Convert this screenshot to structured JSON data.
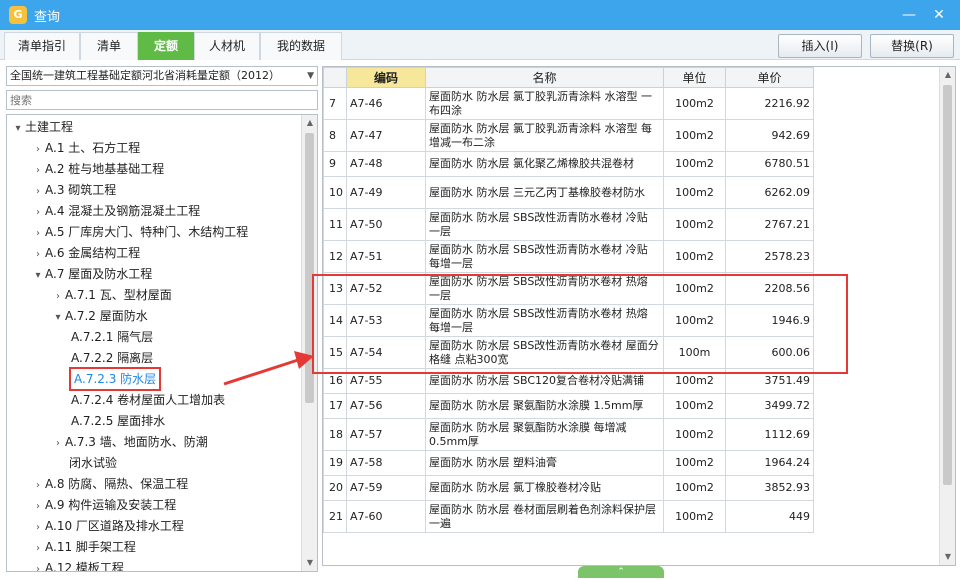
{
  "window": {
    "title": "查询",
    "app_icon": "G",
    "minimize": "—",
    "close": "✕"
  },
  "tabs": [
    "清单指引",
    "清单",
    "定额",
    "人材机",
    "我的数据"
  ],
  "active_tab": 2,
  "actions": {
    "insert": "插入(I)",
    "replace": "替换(R)"
  },
  "left": {
    "dropdown_value": "全国统一建筑工程基础定额河北省消耗量定额（2012）",
    "search_placeholder": "搜索",
    "tree": [
      {
        "label": "土建工程",
        "level": 0,
        "arrow": "▾"
      },
      {
        "label": "A.1 土、石方工程",
        "level": 1,
        "arrow": "›"
      },
      {
        "label": "A.2 桩与地基基础工程",
        "level": 1,
        "arrow": "›"
      },
      {
        "label": "A.3 砌筑工程",
        "level": 1,
        "arrow": "›"
      },
      {
        "label": "A.4 混凝土及钢筋混凝土工程",
        "level": 1,
        "arrow": "›"
      },
      {
        "label": "A.5 厂库房大门、特种门、木结构工程",
        "level": 1,
        "arrow": "›"
      },
      {
        "label": "A.6 金属结构工程",
        "level": 1,
        "arrow": "›"
      },
      {
        "label": "A.7 屋面及防水工程",
        "level": 1,
        "arrow": "▾"
      },
      {
        "label": "A.7.1 瓦、型材屋面",
        "level": 2,
        "arrow": "›"
      },
      {
        "label": "A.7.2 屋面防水",
        "level": 2,
        "arrow": "▾"
      },
      {
        "label": "A.7.2.1 隔气层",
        "level": 3,
        "arrow": ""
      },
      {
        "label": "A.7.2.2 隔离层",
        "level": 3,
        "arrow": ""
      },
      {
        "label": "A.7.2.3 防水层",
        "level": 3,
        "arrow": "",
        "selected": true
      },
      {
        "label": "A.7.2.4 卷材屋面人工增加表",
        "level": 3,
        "arrow": ""
      },
      {
        "label": "A.7.2.5 屋面排水",
        "level": 3,
        "arrow": "›"
      },
      {
        "label": "A.7.3 墙、地面防水、防潮",
        "level": 2,
        "arrow": "›"
      },
      {
        "label": "闭水试验",
        "level": 2,
        "arrow": "",
        "continuation": true
      },
      {
        "label": "A.8 防腐、隔热、保温工程",
        "level": 1,
        "arrow": "›"
      },
      {
        "label": "A.9 构件运输及安装工程",
        "level": 1,
        "arrow": "›"
      },
      {
        "label": "A.10 厂区道路及排水工程",
        "level": 1,
        "arrow": "›"
      },
      {
        "label": "A.11 脚手架工程",
        "level": 1,
        "arrow": "›"
      },
      {
        "label": "A.12 模板工程",
        "level": 1,
        "arrow": "›"
      }
    ]
  },
  "grid": {
    "columns": [
      "",
      "编码",
      "名称",
      "单位",
      "单价"
    ],
    "rows": [
      {
        "no": "7",
        "code": "A7-46",
        "name": "屋面防水 防水层 氯丁胶乳沥青涂料 水溶型 一布四涂",
        "unit": "100m2",
        "price": "2216.92"
      },
      {
        "no": "8",
        "code": "A7-47",
        "name": "屋面防水 防水层 氯丁胶乳沥青涂料 水溶型 每增减一布二涂",
        "unit": "100m2",
        "price": "942.69"
      },
      {
        "no": "9",
        "code": "A7-48",
        "name": "屋面防水 防水层 氯化聚乙烯橡胶共混卷材",
        "unit": "100m2",
        "price": "6780.51"
      },
      {
        "no": "10",
        "code": "A7-49",
        "name": "屋面防水 防水层 三元乙丙丁基橡胶卷材防水",
        "unit": "100m2",
        "price": "6262.09"
      },
      {
        "no": "11",
        "code": "A7-50",
        "name": "屋面防水 防水层 SBS改性沥青防水卷材 冷贴 一层",
        "unit": "100m2",
        "price": "2767.21"
      },
      {
        "no": "12",
        "code": "A7-51",
        "name": "屋面防水 防水层 SBS改性沥青防水卷材 冷贴 每增一层",
        "unit": "100m2",
        "price": "2578.23"
      },
      {
        "no": "13",
        "code": "A7-52",
        "name": "屋面防水 防水层 SBS改性沥青防水卷材 热熔 一层",
        "unit": "100m2",
        "price": "2208.56"
      },
      {
        "no": "14",
        "code": "A7-53",
        "name": "屋面防水 防水层 SBS改性沥青防水卷材 热熔 每增一层",
        "unit": "100m2",
        "price": "1946.9"
      },
      {
        "no": "15",
        "code": "A7-54",
        "name": "屋面防水 防水层 SBS改性沥青防水卷材 屋面分格缝 点粘300宽",
        "unit": "100m",
        "price": "600.06"
      },
      {
        "no": "16",
        "code": "A7-55",
        "name": "屋面防水 防水层 SBC120复合卷材冷贴满铺",
        "unit": "100m2",
        "price": "3751.49"
      },
      {
        "no": "17",
        "code": "A7-56",
        "name": "屋面防水 防水层 聚氨酯防水涂膜 1.5mm厚",
        "unit": "100m2",
        "price": "3499.72"
      },
      {
        "no": "18",
        "code": "A7-57",
        "name": "屋面防水 防水层 聚氨酯防水涂膜 每增减0.5mm厚",
        "unit": "100m2",
        "price": "1112.69"
      },
      {
        "no": "19",
        "code": "A7-58",
        "name": "屋面防水 防水层 塑料油膏",
        "unit": "100m2",
        "price": "1964.24"
      },
      {
        "no": "20",
        "code": "A7-59",
        "name": "屋面防水 防水层 氯丁橡胶卷材冷贴",
        "unit": "100m2",
        "price": "3852.93"
      },
      {
        "no": "21",
        "code": "A7-60",
        "name": "屋面防水 防水层 卷材面层刷着色剂涂料保护层一遍",
        "unit": "100m2",
        "price": "449"
      }
    ]
  },
  "colors": {
    "titlebar": "#3da5ec",
    "active_tab": "#5fba46",
    "highlight": "#e53935",
    "link": "#1e88e5",
    "sorted_header": "#f6e79a"
  }
}
